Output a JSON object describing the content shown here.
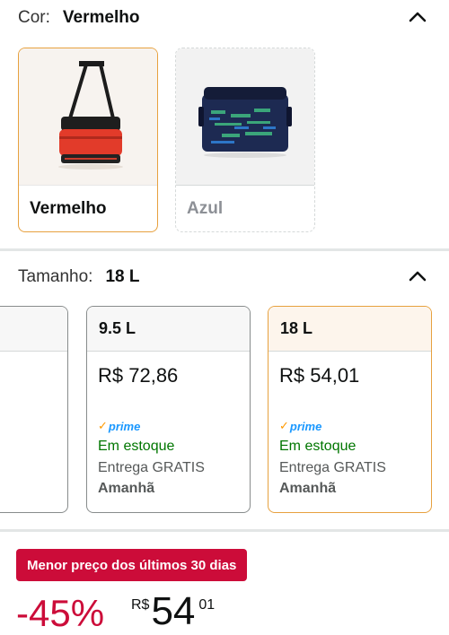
{
  "color_section": {
    "label": "Cor:",
    "selected": "Vermelho",
    "options": [
      {
        "name": "Vermelho",
        "state": "selected"
      },
      {
        "name": "Azul",
        "state": "unavailable"
      }
    ]
  },
  "size_section": {
    "label": "Tamanho:",
    "selected": "18 L",
    "options": [
      {
        "size": "9.5 L",
        "price": "R$ 72,86",
        "prime": "prime",
        "stock": "Em estoque",
        "delivery": "Entrega GRATIS",
        "day": "Amanhã"
      },
      {
        "size": "18 L",
        "price": "R$ 54,01",
        "prime": "prime",
        "stock": "Em estoque",
        "delivery": "Entrega GRATIS",
        "day": "Amanhã"
      }
    ]
  },
  "deal": {
    "badge": "Menor preço dos últimos 30 dias",
    "discount": "-45%",
    "currency": "R$",
    "whole": "54",
    "fraction": "01"
  },
  "colors": {
    "accent_selected": "#e7a13f",
    "deal_red": "#cc0c39",
    "in_stock_green": "#007600",
    "prime_blue": "#1a98ff"
  }
}
